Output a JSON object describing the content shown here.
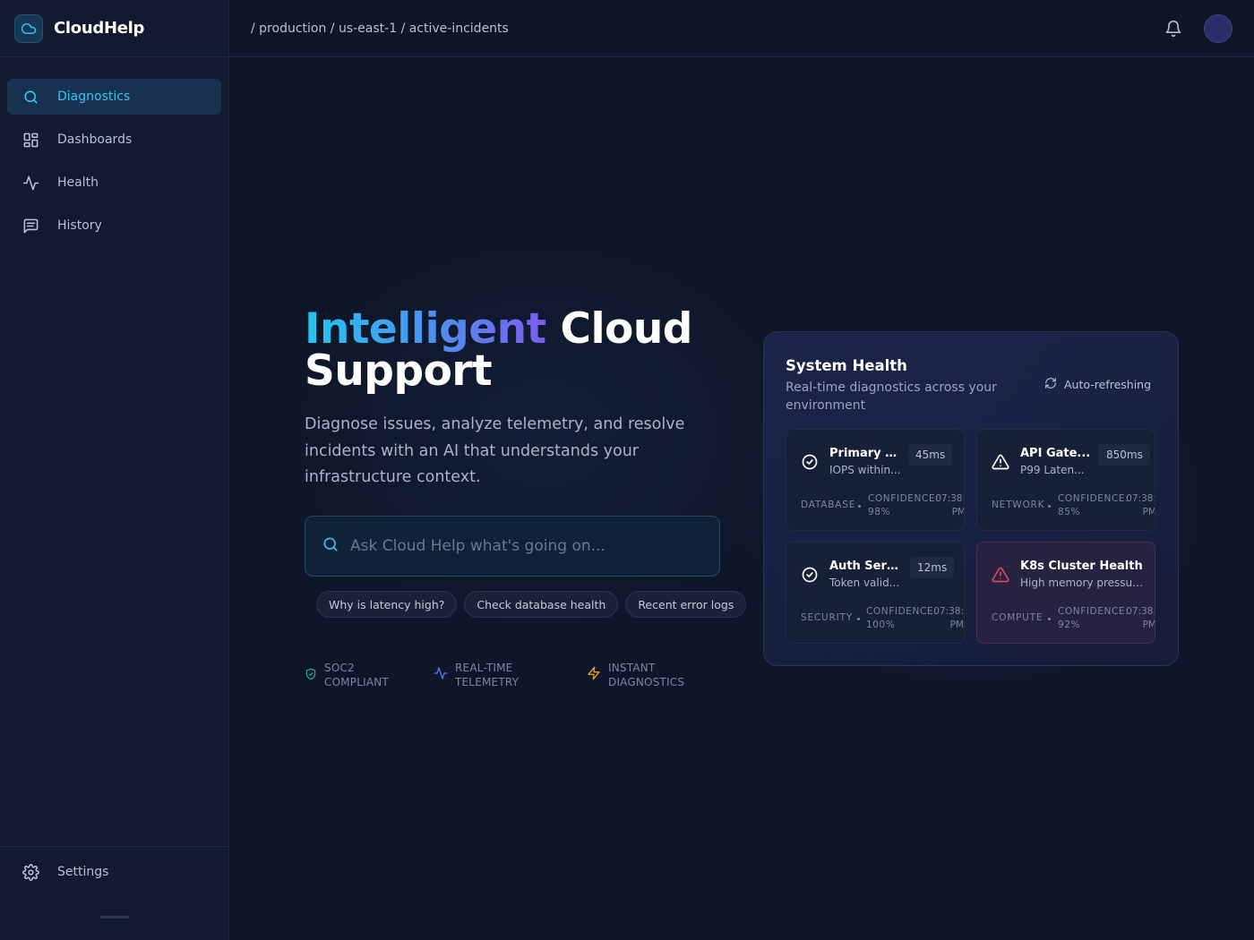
{
  "brand": {
    "name": "CloudHelp"
  },
  "sidebar": {
    "items": [
      {
        "label": "Diagnostics",
        "icon": "search-icon",
        "active": true
      },
      {
        "label": "Dashboards",
        "icon": "dashboard-icon",
        "active": false
      },
      {
        "label": "Health",
        "icon": "activity-icon",
        "active": false
      },
      {
        "label": "History",
        "icon": "history-icon",
        "active": false
      }
    ],
    "settings_label": "Settings"
  },
  "header": {
    "breadcrumb": "/ production / us-east-1 / active-incidents"
  },
  "hero": {
    "title_highlight": "Intelligent",
    "title_rest_1": "Cloud",
    "title_rest_2": "Support",
    "subtitle": "Diagnose issues, analyze telemetry, and resolve incidents with an AI that understands your infrastructure context.",
    "search_placeholder": "Ask Cloud Help what's going on...",
    "chips": [
      "Why is latency high?",
      "Check database health",
      "Recent error logs"
    ],
    "badges": [
      {
        "line1": "SOC2",
        "line2": "COMPLIANT",
        "icon": "shield-check-icon",
        "color": "#21b39a"
      },
      {
        "line1": "REAL-TIME",
        "line2": "TELEMETRY",
        "icon": "activity-icon",
        "color": "#4f7cf0"
      },
      {
        "line1": "INSTANT",
        "line2": "DIAGNOSTICS",
        "icon": "bolt-icon",
        "color": "#e0a030"
      }
    ]
  },
  "health": {
    "title": "System Health",
    "subtitle": "Real-time diagnostics across your environment",
    "auto_label": "Auto-refreshing",
    "cards": [
      {
        "name": "Primary D...",
        "desc": "IOPS within...",
        "latency": "45ms",
        "category": "DATABASE",
        "confidence_label": "CONFIDENCE:",
        "confidence": "98%",
        "time": "07:38:",
        "time2": "PM",
        "status": "ok"
      },
      {
        "name": "API Gate...",
        "desc": "P99 Laten...",
        "latency": "850ms",
        "category": "NETWORK",
        "confidence_label": "CONFIDENCE:",
        "confidence": "85%",
        "time": "07:38:",
        "time2": "PM",
        "status": "warning"
      },
      {
        "name": "Auth Servi...",
        "desc": "Token valid...",
        "latency": "12ms",
        "category": "SECURITY",
        "confidence_label": "CONFIDENCE:",
        "confidence": "100%",
        "time": "07:38:",
        "time2": "PM",
        "status": "ok"
      },
      {
        "name": "K8s Cluster Health",
        "desc": "High memory pressur...",
        "latency": "",
        "category": "COMPUTE",
        "confidence_label": "CONFIDENCE:",
        "confidence": "92%",
        "time": "07:38:",
        "time2": "PM",
        "status": "critical"
      }
    ]
  },
  "colors": {
    "accent": "#37c2f0",
    "critical": "#e0455f",
    "background": "#0f1629"
  }
}
